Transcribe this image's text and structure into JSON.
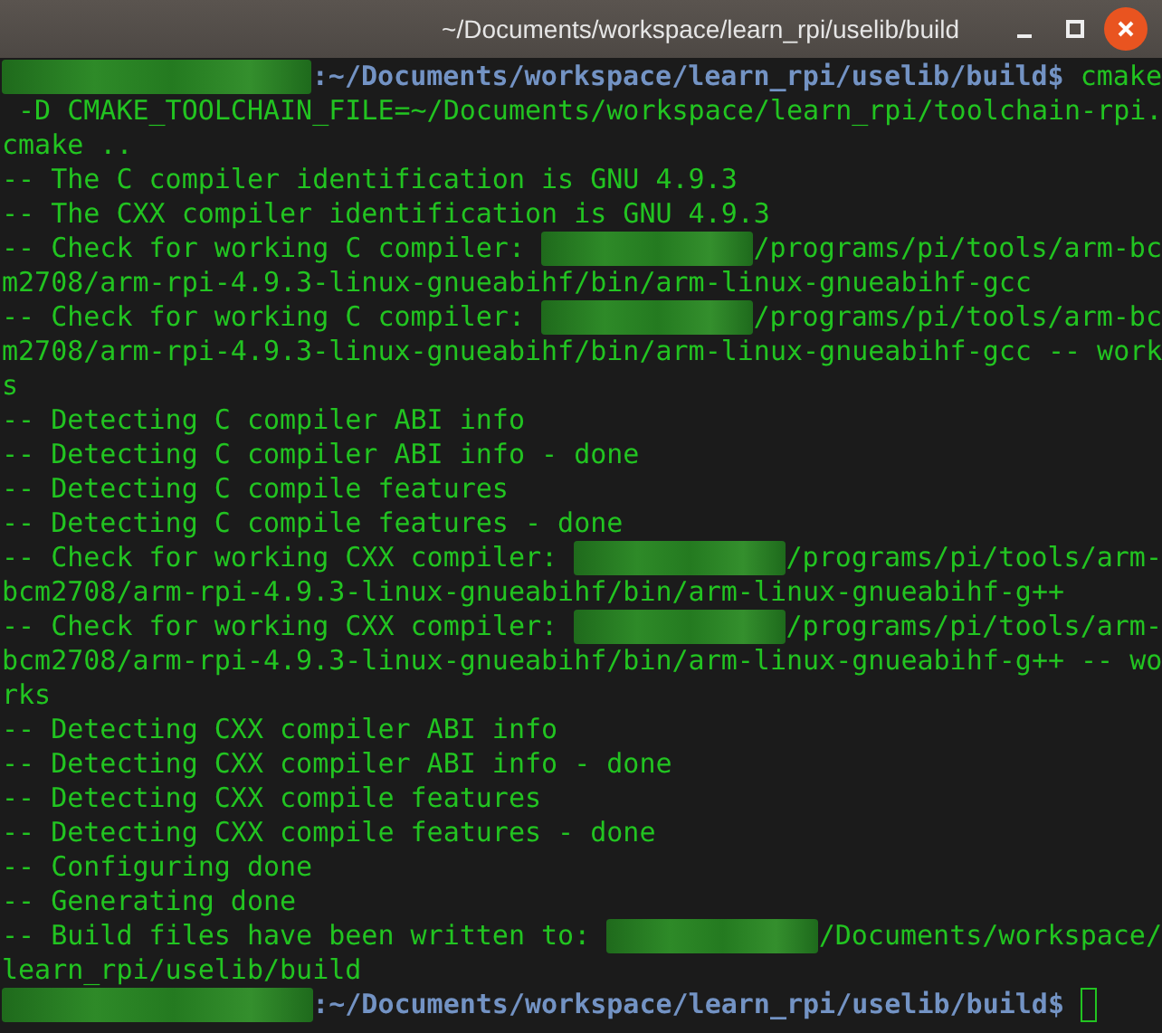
{
  "window": {
    "title": "~/Documents/workspace/learn_rpi/uselib/build",
    "controls": [
      {
        "kind": "minimize"
      },
      {
        "kind": "maximize"
      },
      {
        "kind": "close"
      }
    ]
  },
  "terminal": {
    "rows": [
      [
        {
          "kind": "redacted-user"
        },
        {
          "kind": "path",
          "text": ":~/Documents/workspace/learn_rpi/uselib/build$ "
        },
        {
          "kind": "output",
          "text": "cmake"
        }
      ],
      [
        {
          "kind": "output",
          "text": " -D CMAKE_TOOLCHAIN_FILE=~/Documents/workspace/learn_rpi/toolchain-rpi."
        }
      ],
      [
        {
          "kind": "output",
          "text": "cmake .."
        }
      ],
      [
        {
          "kind": "output",
          "text": "-- The C compiler identification is GNU 4.9.3"
        }
      ],
      [
        {
          "kind": "output",
          "text": "-- The CXX compiler identification is GNU 4.9.3"
        }
      ],
      [
        {
          "kind": "output",
          "text": "-- Check for working C compiler: "
        },
        {
          "kind": "redacted-home"
        },
        {
          "kind": "output",
          "text": "/programs/pi/tools/arm-bc"
        }
      ],
      [
        {
          "kind": "output",
          "text": "m2708/arm-rpi-4.9.3-linux-gnueabihf/bin/arm-linux-gnueabihf-gcc"
        }
      ],
      [
        {
          "kind": "output",
          "text": "-- Check for working C compiler: "
        },
        {
          "kind": "redacted-home"
        },
        {
          "kind": "output",
          "text": "/programs/pi/tools/arm-bc"
        }
      ],
      [
        {
          "kind": "output",
          "text": "m2708/arm-rpi-4.9.3-linux-gnueabihf/bin/arm-linux-gnueabihf-gcc -- work"
        }
      ],
      [
        {
          "kind": "output",
          "text": "s"
        }
      ],
      [
        {
          "kind": "output",
          "text": "-- Detecting C compiler ABI info"
        }
      ],
      [
        {
          "kind": "output",
          "text": "-- Detecting C compiler ABI info - done"
        }
      ],
      [
        {
          "kind": "output",
          "text": "-- Detecting C compile features"
        }
      ],
      [
        {
          "kind": "output",
          "text": "-- Detecting C compile features - done"
        }
      ],
      [
        {
          "kind": "output",
          "text": "-- Check for working CXX compiler: "
        },
        {
          "kind": "redacted-home"
        },
        {
          "kind": "output",
          "text": "/programs/pi/tools/arm-"
        }
      ],
      [
        {
          "kind": "output",
          "text": "bcm2708/arm-rpi-4.9.3-linux-gnueabihf/bin/arm-linux-gnueabihf-g++"
        }
      ],
      [
        {
          "kind": "output",
          "text": "-- Check for working CXX compiler: "
        },
        {
          "kind": "redacted-home"
        },
        {
          "kind": "output",
          "text": "/programs/pi/tools/arm-"
        }
      ],
      [
        {
          "kind": "output",
          "text": "bcm2708/arm-rpi-4.9.3-linux-gnueabihf/bin/arm-linux-gnueabihf-g++ -- wo"
        }
      ],
      [
        {
          "kind": "output",
          "text": "rks"
        }
      ],
      [
        {
          "kind": "output",
          "text": "-- Detecting CXX compiler ABI info"
        }
      ],
      [
        {
          "kind": "output",
          "text": "-- Detecting CXX compiler ABI info - done"
        }
      ],
      [
        {
          "kind": "output",
          "text": "-- Detecting CXX compile features"
        }
      ],
      [
        {
          "kind": "output",
          "text": "-- Detecting CXX compile features - done"
        }
      ],
      [
        {
          "kind": "output",
          "text": "-- Configuring done"
        }
      ],
      [
        {
          "kind": "output",
          "text": "-- Generating done"
        }
      ],
      [
        {
          "kind": "output",
          "text": "-- Build files have been written to: "
        },
        {
          "kind": "redacted-home"
        },
        {
          "kind": "output",
          "text": "/Documents/workspace/"
        }
      ],
      [
        {
          "kind": "output",
          "text": "learn_rpi/uselib/build"
        }
      ],
      [
        {
          "kind": "redacted-user"
        },
        {
          "kind": "path",
          "text": ":~/Documents/workspace/learn_rpi/uselib/build$ "
        },
        {
          "kind": "cursor"
        }
      ]
    ]
  }
}
